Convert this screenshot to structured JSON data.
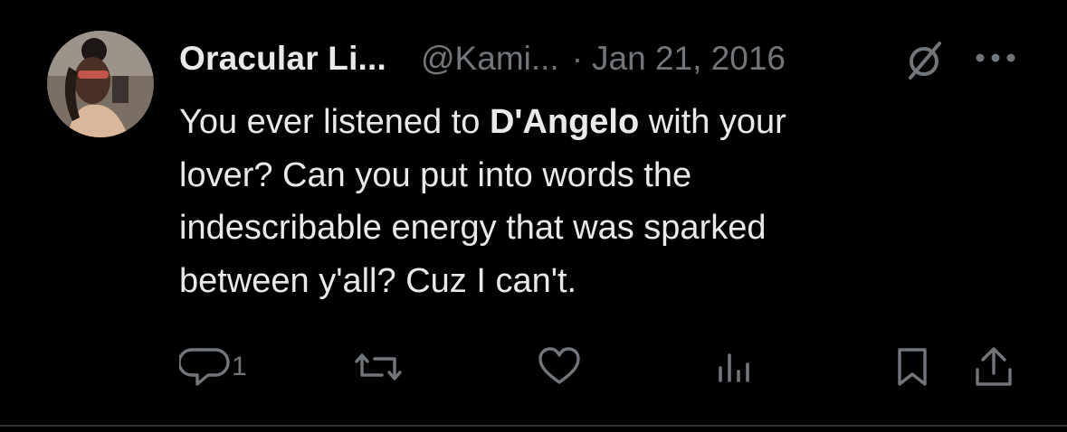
{
  "colors": {
    "background": "#000000",
    "text_primary": "#e7e9ea",
    "text_secondary": "#71767b",
    "divider": "#2f3336"
  },
  "tweet": {
    "author": {
      "display_name": "Oracular Li...",
      "handle": "@Kami...",
      "avatar_icon": "profile-photo"
    },
    "separator": "·",
    "date": "Jan 21, 2016",
    "badge_icon": "grok-icon",
    "more_icon": "more-icon",
    "body": {
      "line1_before": "You ever listened to ",
      "line1_bold": "D'Angelo",
      "line1_after": " with your",
      "line2": "lover? Can you put into words the",
      "line3": "indescribable energy that was sparked",
      "line4": "between y'all? Cuz I can't."
    },
    "actions": {
      "reply": {
        "icon": "reply-icon",
        "count": "1"
      },
      "retweet": {
        "icon": "retweet-icon",
        "count": ""
      },
      "like": {
        "icon": "heart-icon",
        "count": ""
      },
      "views": {
        "icon": "analytics-icon",
        "count": ""
      },
      "bookmark": {
        "icon": "bookmark-icon"
      },
      "share": {
        "icon": "share-icon"
      }
    }
  }
}
